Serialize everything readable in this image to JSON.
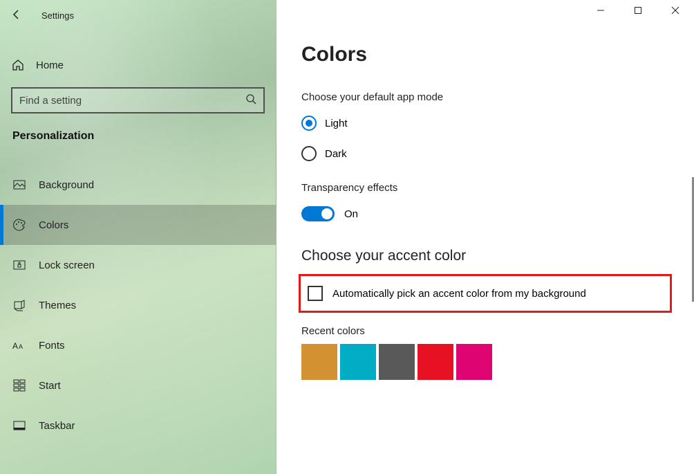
{
  "app": {
    "title": "Settings"
  },
  "sidebar": {
    "home": "Home",
    "search_placeholder": "Find a setting",
    "category": "Personalization",
    "items": [
      {
        "label": "Background",
        "selected": false
      },
      {
        "label": "Colors",
        "selected": true
      },
      {
        "label": "Lock screen",
        "selected": false
      },
      {
        "label": "Themes",
        "selected": false
      },
      {
        "label": "Fonts",
        "selected": false
      },
      {
        "label": "Start",
        "selected": false
      },
      {
        "label": "Taskbar",
        "selected": false
      }
    ]
  },
  "page": {
    "title": "Colors",
    "app_mode": {
      "heading": "Choose your default app mode",
      "options": {
        "light": "Light",
        "dark": "Dark"
      },
      "selected": "light"
    },
    "transparency": {
      "heading": "Transparency effects",
      "state_label": "On",
      "on": true
    },
    "accent": {
      "heading": "Choose your accent color",
      "auto_label": "Automatically pick an accent color from my background",
      "auto_checked": false,
      "recent_label": "Recent colors",
      "recent_colors": [
        "#d39131",
        "#00adc4",
        "#595959",
        "#e81123",
        "#de0573"
      ]
    }
  }
}
